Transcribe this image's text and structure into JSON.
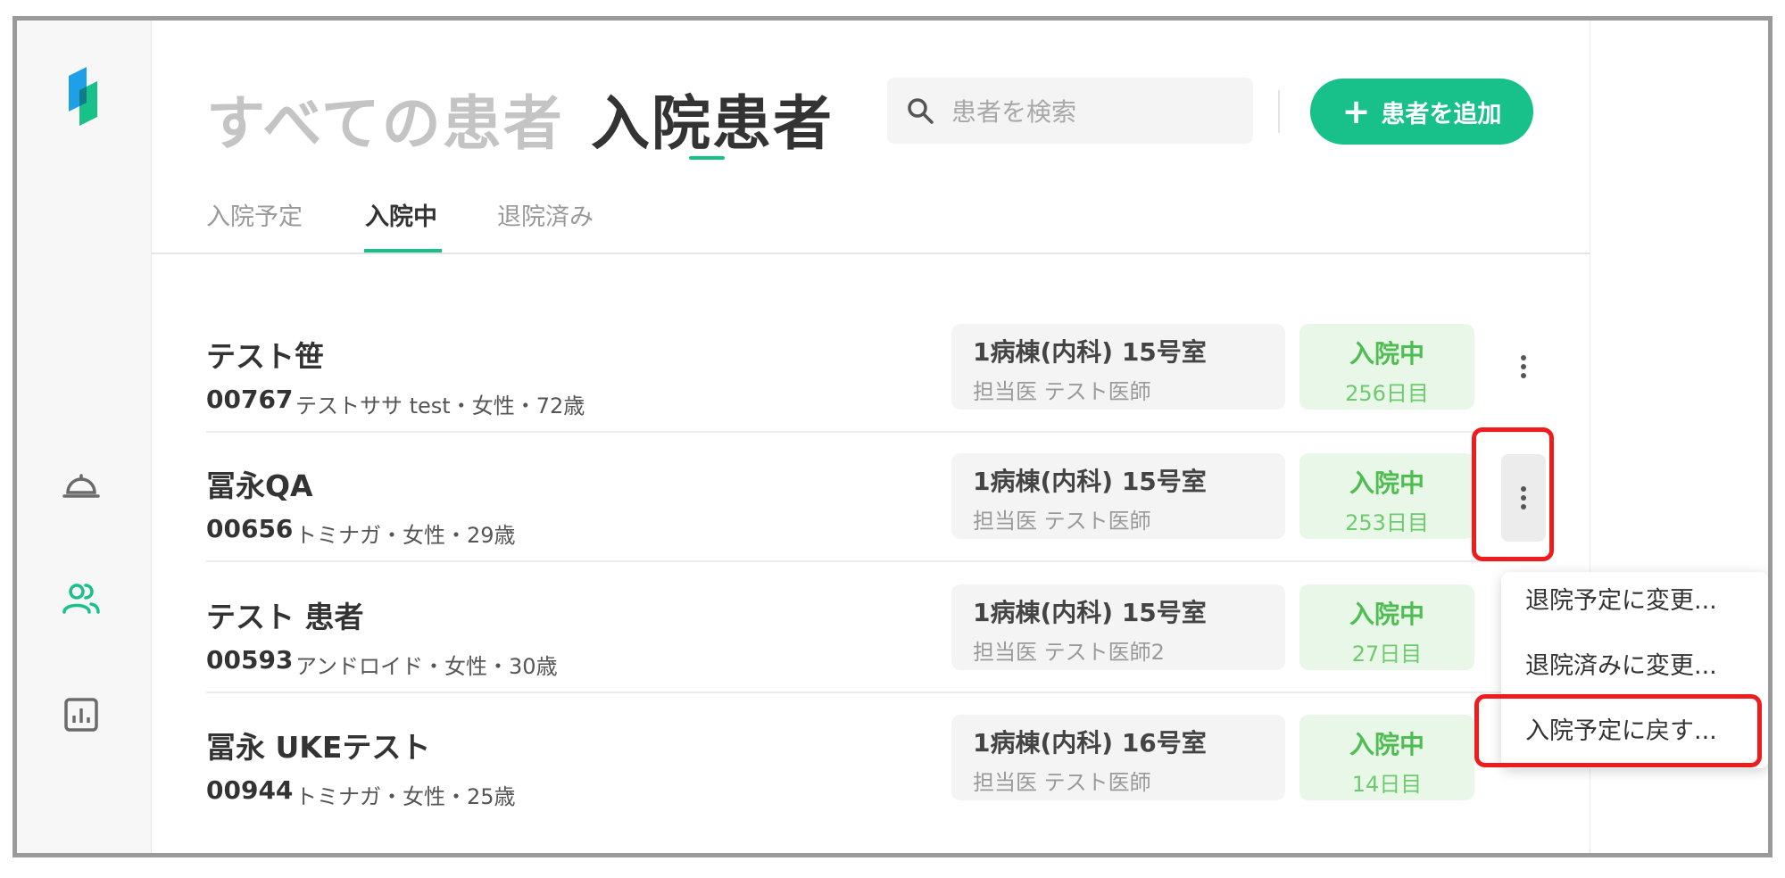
{
  "header": {
    "title_all": "すべての患者",
    "title_inpatient": "入院患者",
    "add_button_label": "患者を追加"
  },
  "search": {
    "placeholder": "患者を検索",
    "value": ""
  },
  "tabs": [
    {
      "label": "入院予定",
      "active": false
    },
    {
      "label": "入院中",
      "active": true
    },
    {
      "label": "退院済み",
      "active": false
    }
  ],
  "patients": [
    {
      "name": "テスト笹",
      "id": "00767",
      "meta": "テストササ test・女性・72歳",
      "room": "1病棟(内科) 15号室",
      "doctor": "担当医 テスト医師",
      "status": "入院中",
      "days": "256日目"
    },
    {
      "name": "冨永QA",
      "id": "00656",
      "meta": "トミナガ・女性・29歳",
      "room": "1病棟(内科) 15号室",
      "doctor": "担当医 テスト医師",
      "status": "入院中",
      "days": "253日目"
    },
    {
      "name": "テスト 患者",
      "id": "00593",
      "meta": "アンドロイド・女性・30歳",
      "room": "1病棟(内科) 15号室",
      "doctor": "担当医 テスト医師2",
      "status": "入院中",
      "days": "27日目"
    },
    {
      "name": "冨永 UKEテスト",
      "id": "00944",
      "meta": "トミナガ・女性・25歳",
      "room": "1病棟(内科) 16号室",
      "doctor": "担当医 テスト医師",
      "status": "入院中",
      "days": "14日目"
    }
  ],
  "context_menu": {
    "items": [
      {
        "label": "退院予定に変更..."
      },
      {
        "label": "退院済みに変更..."
      },
      {
        "label": "入院予定に戻す..."
      }
    ]
  },
  "sidebar": {
    "items": [
      {
        "icon": "hospital-bell-icon",
        "active": false
      },
      {
        "icon": "users-icon",
        "active": true
      },
      {
        "icon": "bar-chart-icon",
        "active": false
      }
    ]
  },
  "colors": {
    "accent": "#19c18a",
    "status_green": "#4fbe52",
    "status_bg": "#e9f7e9",
    "highlight_red": "#ee1c1c",
    "muted_title": "#c4c4c4"
  }
}
